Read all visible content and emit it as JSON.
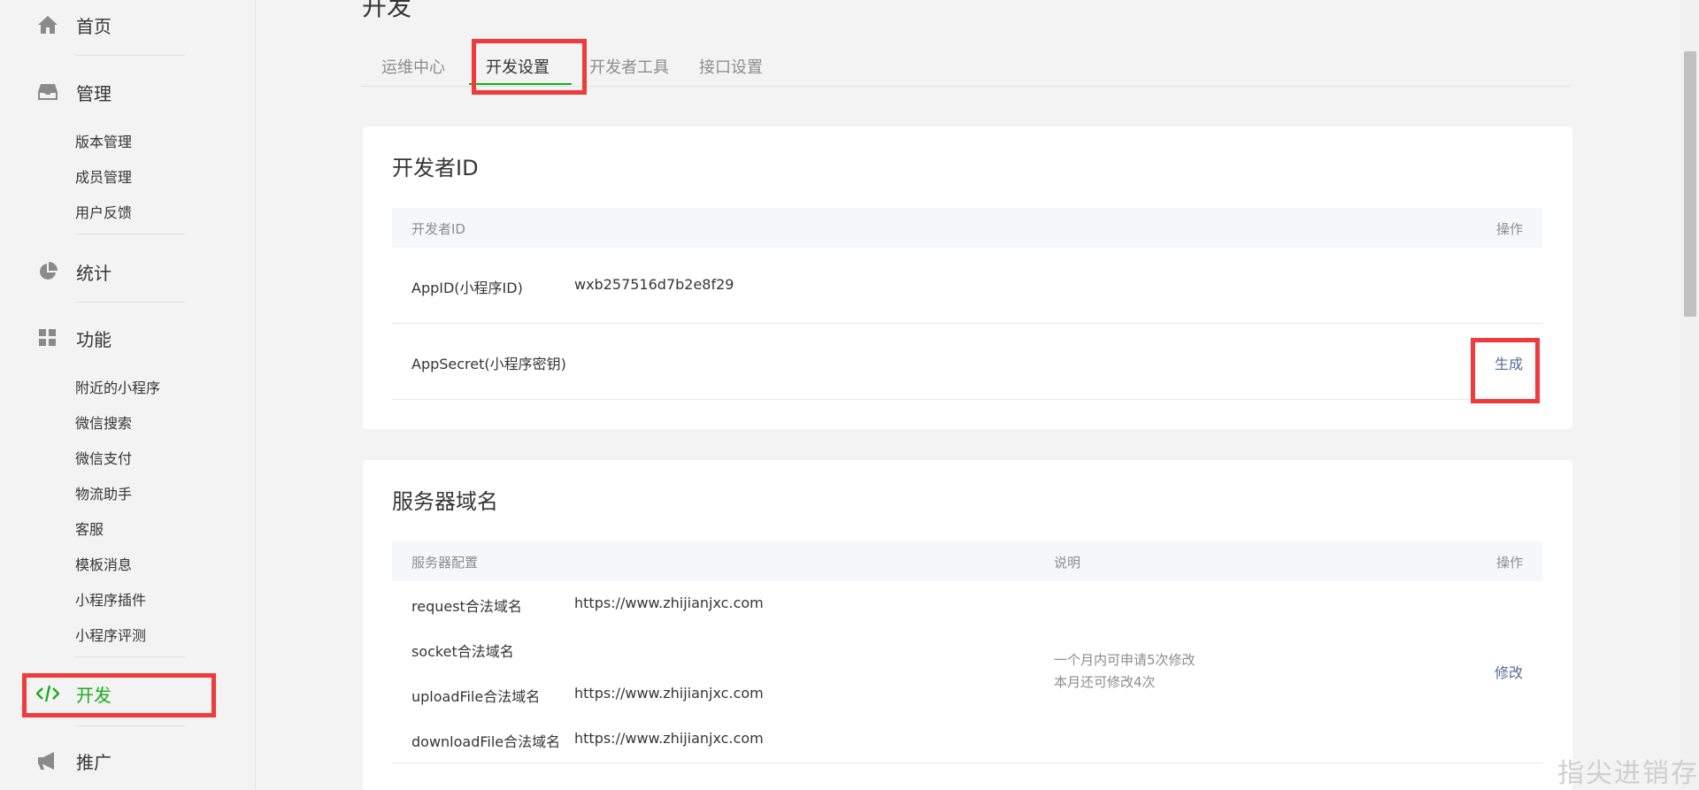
{
  "sidebar": {
    "home": "首页",
    "manage": {
      "label": "管理",
      "items": [
        "版本管理",
        "成员管理",
        "用户反馈"
      ]
    },
    "stats": "统计",
    "features": {
      "label": "功能",
      "items": [
        "附近的小程序",
        "微信搜索",
        "微信支付",
        "物流助手",
        "客服",
        "模板消息",
        "小程序插件",
        "小程序评测"
      ]
    },
    "dev": "开发",
    "promote": "推广"
  },
  "main": {
    "title": "开发",
    "tabs": [
      "运维中心",
      "开发设置",
      "开发者工具",
      "接口设置"
    ],
    "active_tab": "开发设置"
  },
  "devid_card": {
    "title": "开发者ID",
    "col_id": "开发者ID",
    "col_op": "操作",
    "appid_label": "AppID(小程序ID)",
    "appid_value": "wxb257516d7b2e8f29",
    "secret_label": "AppSecret(小程序密钥)",
    "secret_action": "生成"
  },
  "server_card": {
    "title": "服务器域名",
    "col_config": "服务器配置",
    "col_desc": "说明",
    "col_op": "操作",
    "rows": [
      {
        "label": "request合法域名",
        "value": "https://www.zhijianjxc.com"
      },
      {
        "label": "socket合法域名",
        "value": ""
      },
      {
        "label": "uploadFile合法域名",
        "value": "https://www.zhijianjxc.com"
      },
      {
        "label": "downloadFile合法域名",
        "value": "https://www.zhijianjxc.com"
      }
    ],
    "note1": "一个月内可申请5次修改",
    "note2": "本月还可修改4次",
    "action": "修改"
  },
  "watermark": "指尖进销存",
  "colors": {
    "accent_green": "#1aad19",
    "highlight_red": "#ef3b3b",
    "link_blue": "#576b95"
  }
}
